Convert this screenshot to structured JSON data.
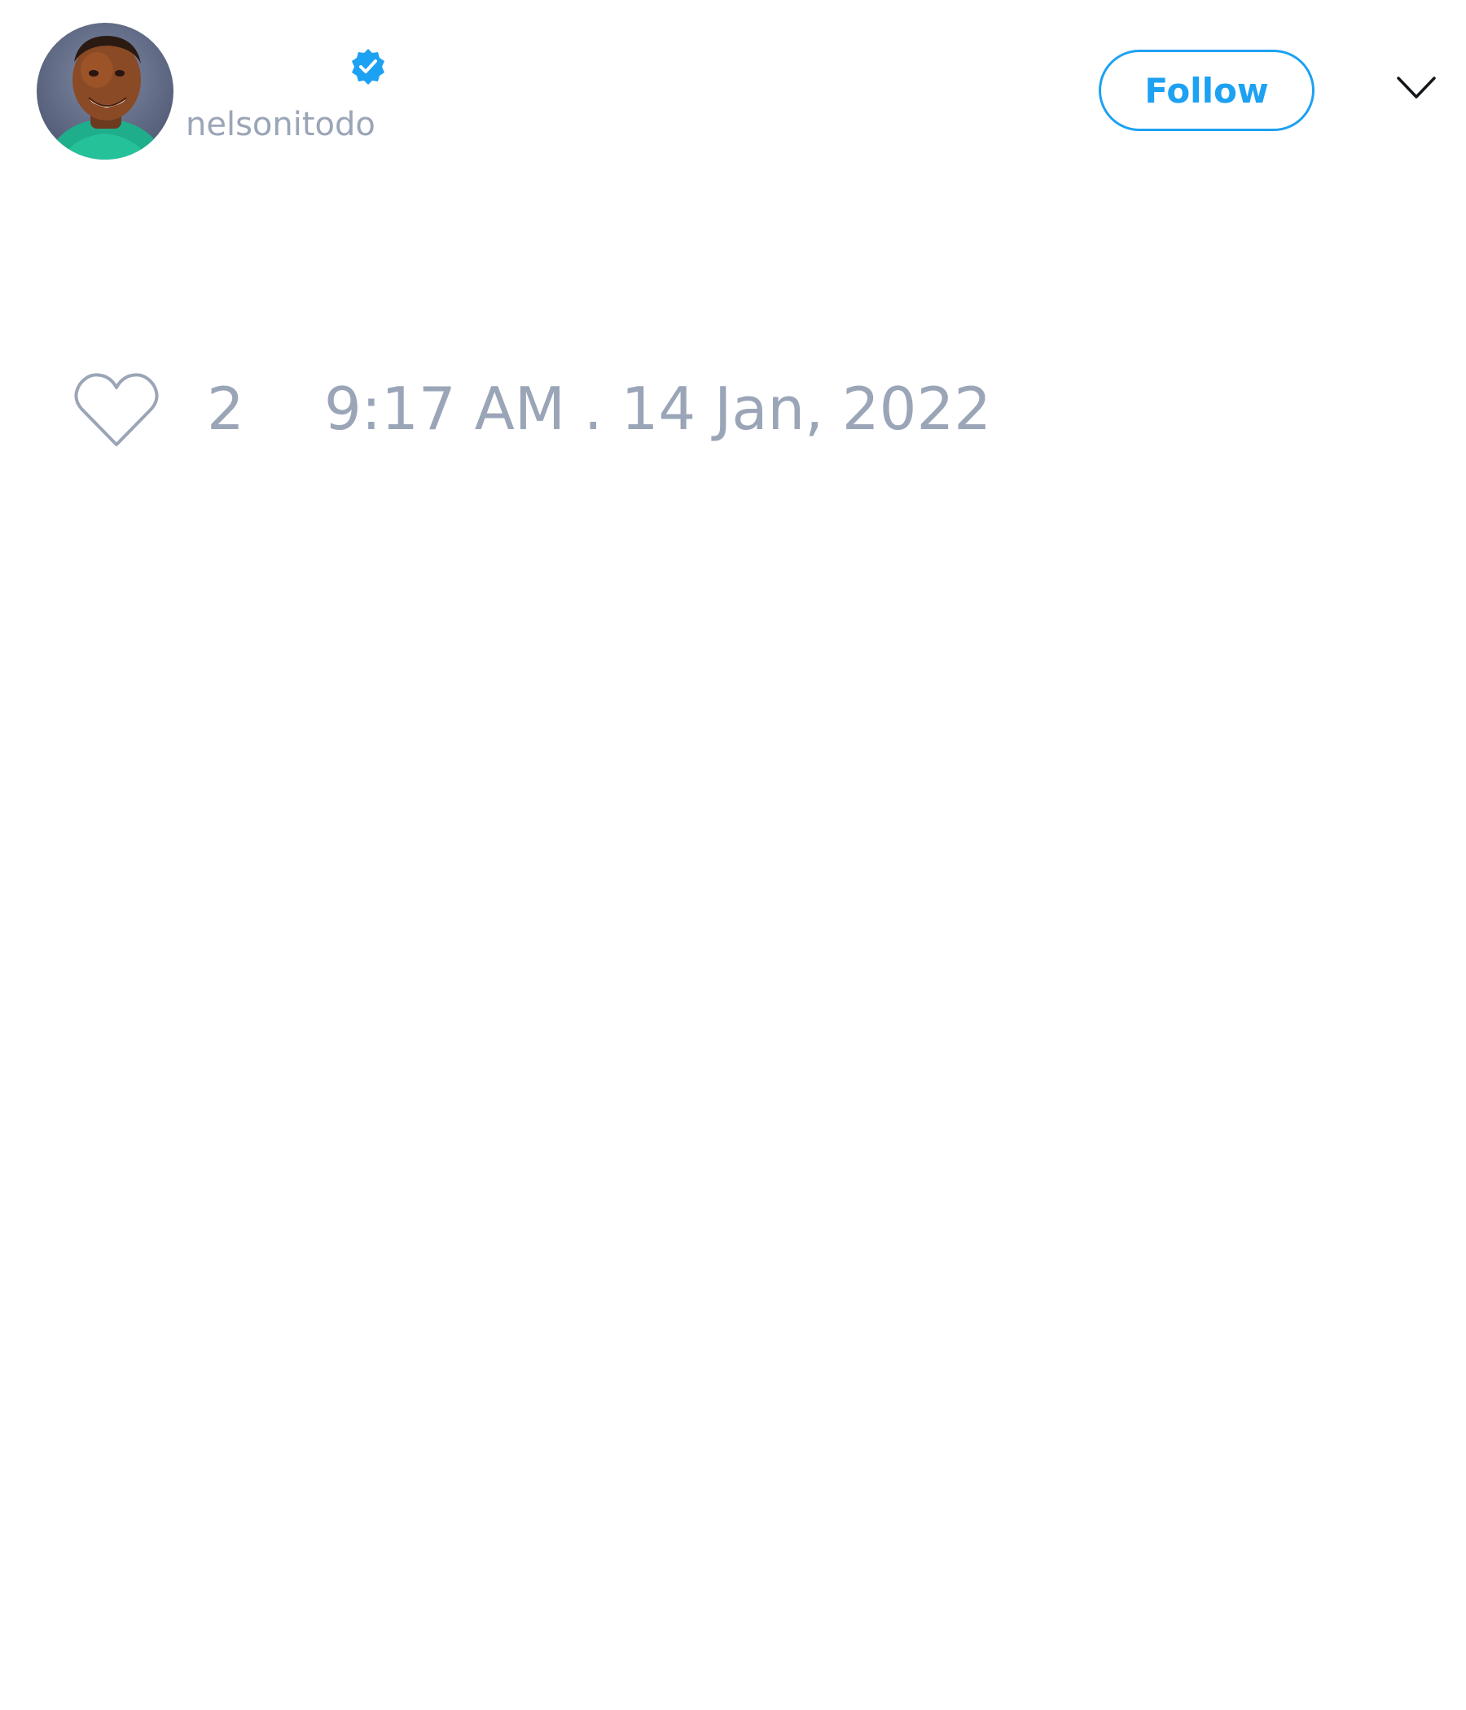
{
  "tweet": {
    "author": {
      "display_name": "",
      "handle": "nelsonitodo",
      "verified": true,
      "avatar_icon": "profile-photo"
    },
    "follow_label": "Follow",
    "menu_icon": "chevron-down-icon",
    "like_icon": "heart-outline-icon",
    "like_count": "2",
    "timestamp": "9:17 AM . 14 Jan, 2022"
  },
  "colors": {
    "accent": "#1da1f2",
    "muted_text": "#9aa5b7",
    "background": "#ffffff",
    "icon_outline": "#9aa5b7",
    "chevron": "#14171a"
  }
}
